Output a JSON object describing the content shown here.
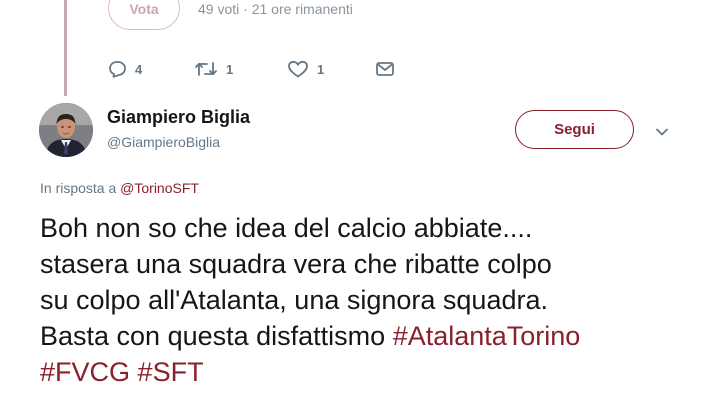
{
  "poll": {
    "vote_label": "Vota",
    "meta": "49 voti · 21 ore rimanenti"
  },
  "actions": {
    "replies": "4",
    "retweets": "1",
    "likes": "1"
  },
  "author": {
    "name": "Giampiero Biglia",
    "handle": "@GiampieroBiglia"
  },
  "follow_label": "Segui",
  "reply_prefix": "In risposta a ",
  "reply_mention": "@TorinoSFT",
  "tweet": {
    "line1": "Boh non so che idea del calcio abbiate....",
    "line2": "stasera una squadra vera che ribatte colpo",
    "line3": "su colpo all'Atalanta,  una signora squadra.",
    "line4_text": "Basta con questa disfattismo ",
    "hashtag1": "#AtalantaTorino",
    "hashtag2": "#FVCG",
    "hashtag3": "#SFT"
  },
  "colors": {
    "accent": "#8b1f2c",
    "muted": "#657786",
    "thread_line": "#c9a9b3"
  },
  "icons": [
    "reply-icon",
    "retweet-icon",
    "like-icon",
    "direct-message-icon",
    "chevron-down-icon"
  ]
}
